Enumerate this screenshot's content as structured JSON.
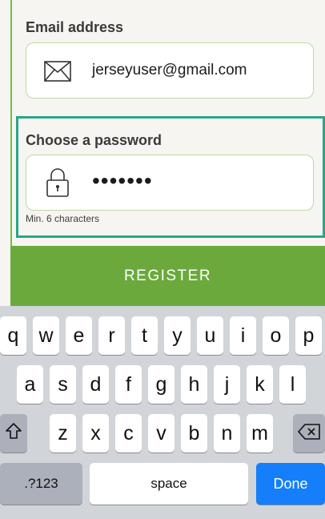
{
  "form": {
    "email_label": "Email address",
    "email_value": "jerseyuser@gmail.com",
    "password_label": "Choose a password",
    "password_value": "•••••••",
    "password_hint": "Min. 6 characters",
    "register_label": "REGISTER"
  },
  "colors": {
    "accent_green": "#6ba93c",
    "highlight_teal": "#2aa588",
    "keyboard_bg": "#d1d4d9",
    "done_blue": "#147efb"
  },
  "keyboard": {
    "row1": [
      "q",
      "w",
      "e",
      "r",
      "t",
      "y",
      "u",
      "i",
      "o",
      "p"
    ],
    "row2": [
      "a",
      "s",
      "d",
      "f",
      "g",
      "h",
      "j",
      "k",
      "l"
    ],
    "row3": [
      "z",
      "x",
      "c",
      "v",
      "b",
      "n",
      "m"
    ],
    "symbols_label": ".?123",
    "space_label": "space",
    "done_label": "Done",
    "shift_icon": "shift-icon",
    "backspace_icon": "backspace-icon"
  }
}
